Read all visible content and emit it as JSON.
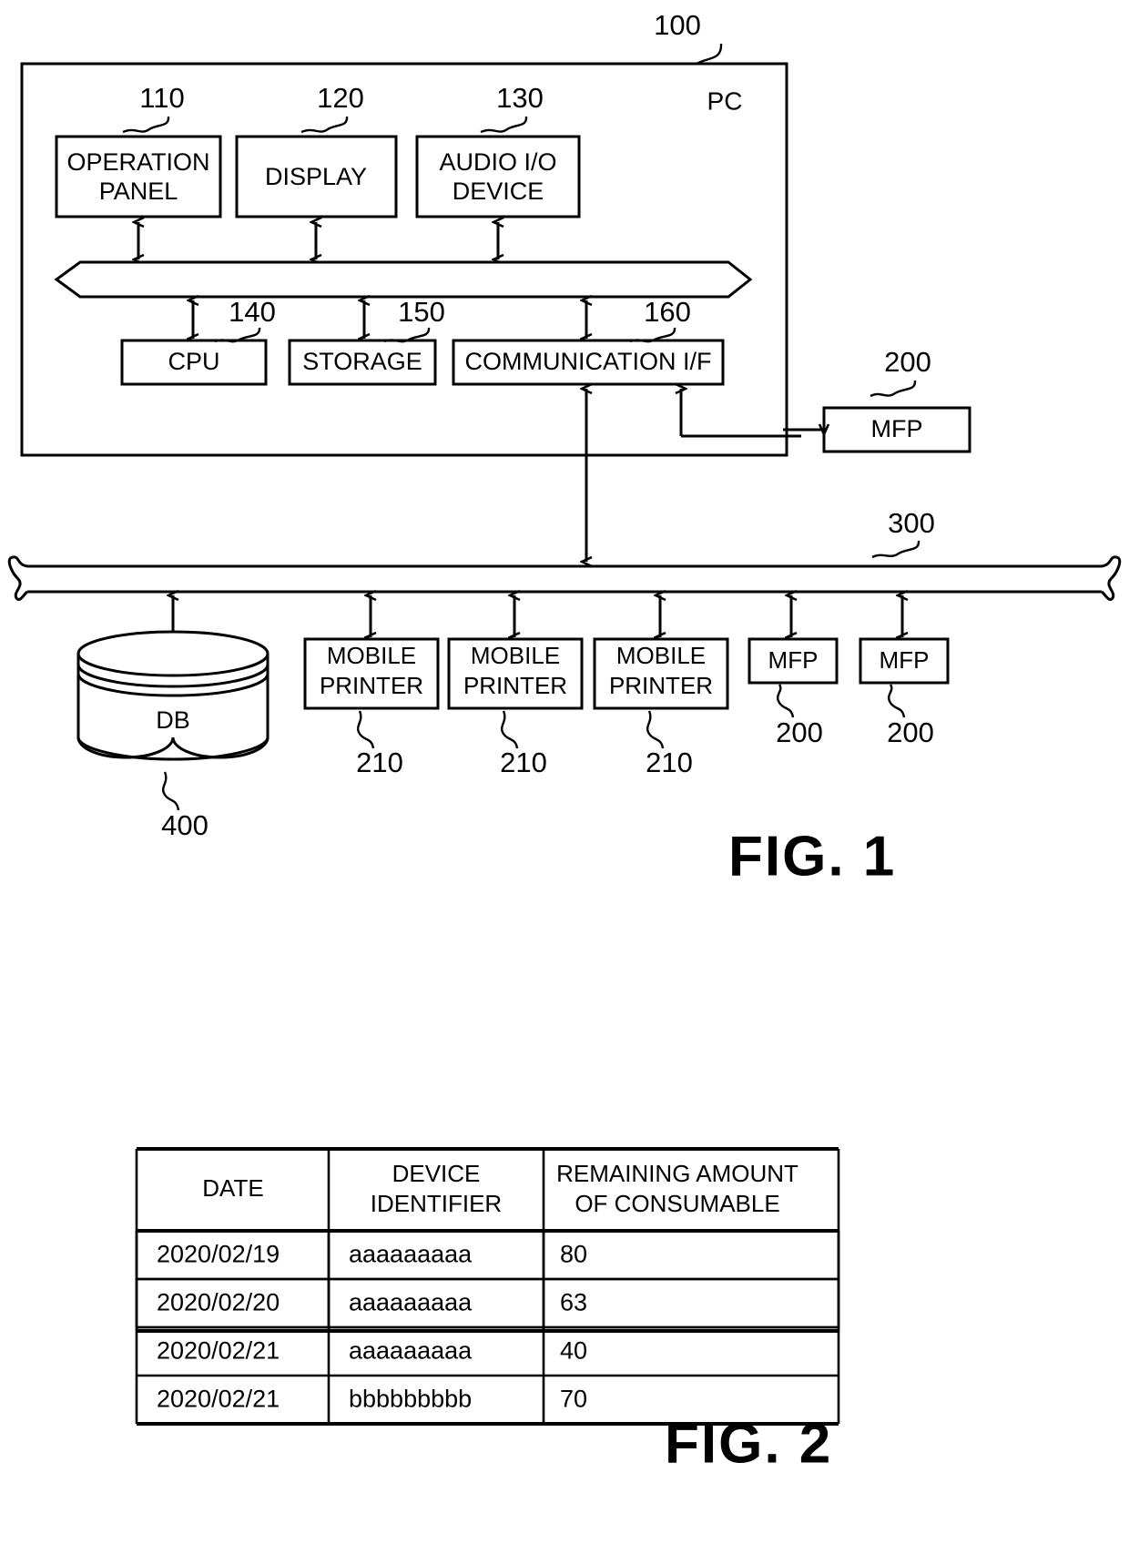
{
  "figure1": {
    "caption": "FIG. 1",
    "pc_label": "PC",
    "pc_ref": "100",
    "components": [
      {
        "label_line1": "OPERATION",
        "label_line2": "PANEL",
        "ref": "110"
      },
      {
        "label_line1": "DISPLAY",
        "label_line2": "",
        "ref": "120"
      },
      {
        "label_line1": "AUDIO I/O",
        "label_line2": "DEVICE",
        "ref": "130"
      }
    ],
    "lower_components": [
      {
        "label": "CPU",
        "ref": "140"
      },
      {
        "label": "STORAGE",
        "ref": "150"
      },
      {
        "label": "COMMUNICATION I/F",
        "ref": "160"
      }
    ],
    "direct_mfp": {
      "label": "MFP",
      "ref": "200"
    },
    "network_ref": "300",
    "network_nodes": [
      {
        "label_line1": "DB",
        "label_line2": "",
        "ref": "400",
        "type": "cylinder"
      },
      {
        "label_line1": "MOBILE",
        "label_line2": "PRINTER",
        "ref": "210",
        "type": "box"
      },
      {
        "label_line1": "MOBILE",
        "label_line2": "PRINTER",
        "ref": "210",
        "type": "box"
      },
      {
        "label_line1": "MOBILE",
        "label_line2": "PRINTER",
        "ref": "210",
        "type": "box"
      },
      {
        "label_line1": "MFP",
        "label_line2": "",
        "ref": "200",
        "type": "box"
      },
      {
        "label_line1": "MFP",
        "label_line2": "",
        "ref": "200",
        "type": "box"
      }
    ]
  },
  "figure2": {
    "caption": "FIG. 2",
    "table": {
      "headers": [
        {
          "line1": "DATE",
          "line2": ""
        },
        {
          "line1": "DEVICE",
          "line2": "IDENTIFIER"
        },
        {
          "line1": "REMAINING AMOUNT",
          "line2": "OF CONSUMABLE"
        }
      ],
      "rows": [
        {
          "date": "2020/02/19",
          "device_identifier": "aaaaaaaaa",
          "remaining_amount": "80"
        },
        {
          "date": "2020/02/20",
          "device_identifier": "aaaaaaaaa",
          "remaining_amount": "63"
        },
        {
          "date": "2020/02/21",
          "device_identifier": "aaaaaaaaa",
          "remaining_amount": "40"
        },
        {
          "date": "2020/02/21",
          "device_identifier": "bbbbbbbbb",
          "remaining_amount": "70"
        }
      ]
    }
  },
  "colors": {
    "ink": "#000000",
    "paper": "#ffffff"
  }
}
